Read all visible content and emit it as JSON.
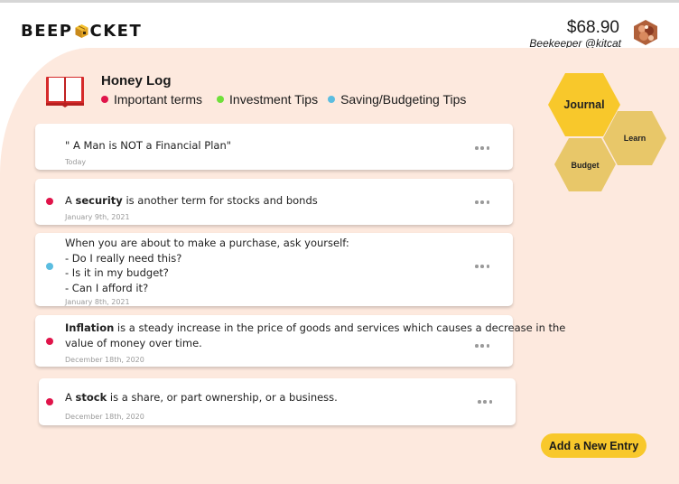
{
  "brand": {
    "left": "BEEP",
    "right": "CKET",
    "icon": "pocket-box-icon"
  },
  "user": {
    "balance": "$68.90",
    "name": "Beekeeper @kitcat"
  },
  "log": {
    "title": "Honey Log",
    "legend": [
      {
        "label": "Important terms",
        "color": "#e0144a"
      },
      {
        "label": "Investment Tips",
        "color": "#6fe03a"
      },
      {
        "label": "Saving/Budgeting Tips",
        "color": "#5bbde0"
      }
    ]
  },
  "entries": [
    {
      "text": "\" A Man is NOT a Financial Plan\"",
      "date": "Today",
      "category": "none"
    },
    {
      "bold": "security",
      "pre": "A ",
      "post": " is another term for stocks and bonds",
      "date": "January 9th, 2021",
      "category": "important",
      "color": "#e0144a"
    },
    {
      "lines": [
        "When you are about to make a purchase, ask yourself:",
        "-  Do I really need this?",
        "- Is it in my budget?",
        "- Can I afford it?"
      ],
      "date": "January 8th, 2021",
      "category": "saving",
      "color": "#5bbde0"
    },
    {
      "bold": "Inflation",
      "post": " is a steady increase in the price of goods and services which causes a decrease in the",
      "line2": "value of money over time.",
      "date": "December 18th, 2020",
      "category": "important",
      "color": "#e0144a"
    },
    {
      "pre": "A ",
      "bold": "stock",
      "post": " is a share, or part ownership, or a business.",
      "date": "December 18th, 2020",
      "category": "important",
      "color": "#e0144a"
    }
  ],
  "nav": {
    "journal": "Journal",
    "learn": "Learn",
    "budget": "Budget"
  },
  "actions": {
    "add_entry": "Add a New Entry"
  },
  "colors": {
    "panel": "#fde9de",
    "hex_active": "#f8c82b",
    "hex": "#e8c769",
    "button": "#f8c82b"
  }
}
